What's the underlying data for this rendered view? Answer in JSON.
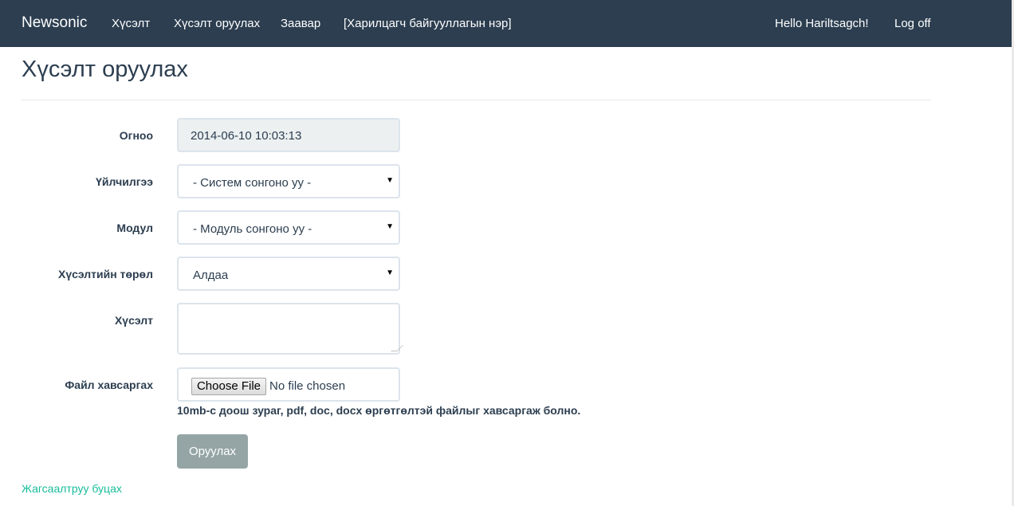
{
  "navbar": {
    "brand": "Newsonic",
    "links": [
      "Хүсэлт",
      "Хүсэлт оруулах",
      "Заавар",
      "[Харилцагч байгууллагын нэр]"
    ],
    "greeting": "Hello Hariltsagch!",
    "logoff": "Log off"
  },
  "page": {
    "title": "Хүсэлт оруулах"
  },
  "form": {
    "date": {
      "label": "Огноо",
      "value": "2014-06-10 10:03:13"
    },
    "service": {
      "label": "Үйлчилгээ",
      "selected": "- Систем сонгоно уу -"
    },
    "module": {
      "label": "Модул",
      "selected": "- Модуль сонгоно уу -"
    },
    "request_type": {
      "label": "Хүсэлтийн төрөл",
      "selected": "Алдаа"
    },
    "request": {
      "label": "Хүсэлт",
      "value": ""
    },
    "attachment": {
      "label": "Файл хавсаргах",
      "button": "Choose File",
      "status": "No file chosen",
      "help": "10mb-с доош зураг, pdf, doc, docx өргөтгөлтэй файлыг хавсаргаж болно."
    },
    "submit_label": "Оруулах"
  },
  "back_link": "Жагсаалтруу буцах",
  "colors": {
    "navbar": "#2c3e50",
    "link": "#18bc9c",
    "submit": "#95a5a6",
    "readonly": "#ecf0f1"
  }
}
